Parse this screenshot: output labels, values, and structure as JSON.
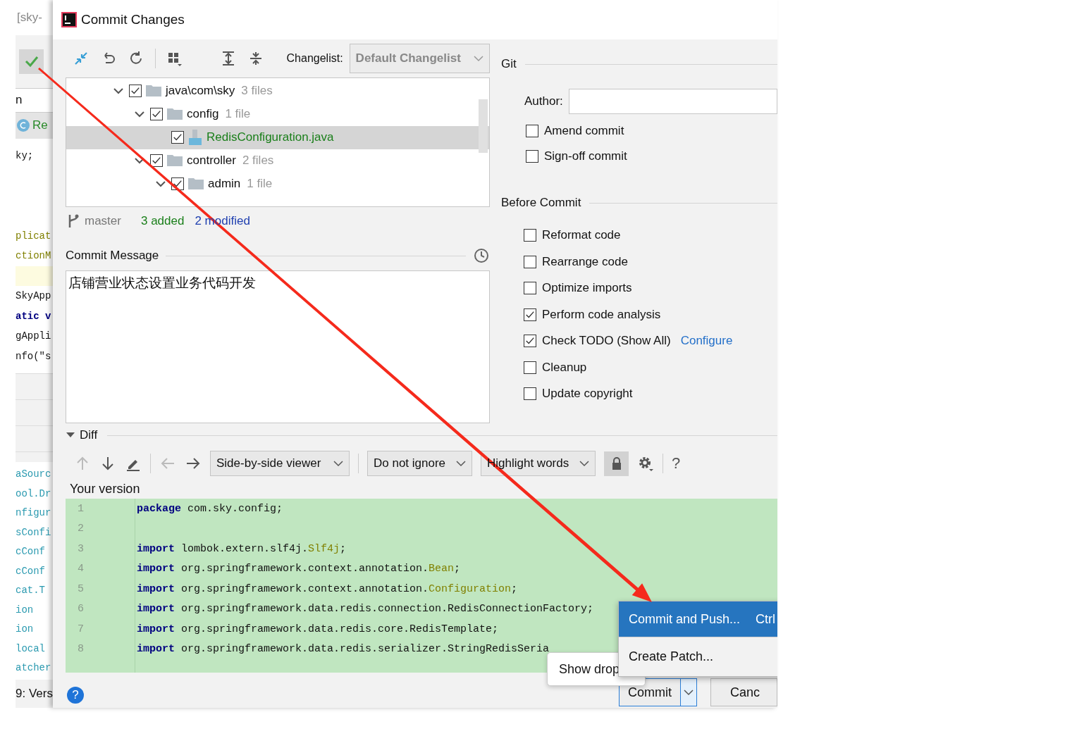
{
  "left_strip": {
    "title": "[sky-",
    "tab": "n",
    "file_tab": "Re",
    "code_groups": [
      [
        {
          "text": "ky;",
          "kind": "plain"
        }
      ],
      [
        {
          "text": "plicat",
          "kind": "annotation"
        },
        {
          "text": "ctionM",
          "kind": "annotation"
        }
      ],
      [
        {
          "text": "SkyApp",
          "kind": "plain"
        },
        {
          "text": "atic v",
          "kind": "keyword"
        },
        {
          "text": "gAppli",
          "kind": "plain"
        },
        {
          "text": "nfo(\"s",
          "kind": "plain"
        }
      ]
    ],
    "list": [
      "aSourc",
      "ool.Dr",
      "nfigur",
      "sConfi",
      "cConf",
      "cConf",
      "cat.T",
      "ion",
      "ion",
      "local",
      "atcher"
    ],
    "footer": "9: Vers"
  },
  "window": {
    "title": "Commit Changes"
  },
  "toolbar": {
    "changelist_label": "Changelist:",
    "changelist": "Default Changelist"
  },
  "tree": [
    {
      "name": "java\\com\\sky",
      "count": "3 files",
      "kind": "folder",
      "checked": true,
      "expanded": true,
      "selected": false,
      "children": [
        {
          "name": "config",
          "count": "1 file",
          "kind": "folder",
          "checked": true,
          "expanded": true,
          "selected": false,
          "children": [
            {
              "name": "RedisConfiguration.java",
              "kind": "added_file",
              "checked": true,
              "selected": true
            }
          ]
        },
        {
          "name": "controller",
          "count": "2 files",
          "kind": "folder",
          "checked": true,
          "expanded": true,
          "selected": false,
          "children": [
            {
              "name": "admin",
              "count": "1 file",
              "kind": "folder",
              "checked": true,
              "expanded": true,
              "selected": false
            }
          ]
        }
      ]
    }
  ],
  "status": {
    "branch": "master",
    "added": "3 added",
    "modified": "2 modified"
  },
  "commit_message": {
    "label": "Commit Message",
    "value": "店铺营业状态设置业务代码开发"
  },
  "git": {
    "title": "Git",
    "author_label": "Author:",
    "options": [
      {
        "label": "Amend commit",
        "checked": false
      },
      {
        "label": "Sign-off commit",
        "checked": false
      }
    ]
  },
  "before_commit": {
    "title": "Before Commit",
    "options": [
      {
        "label": "Reformat code",
        "checked": false
      },
      {
        "label": "Rearrange code",
        "checked": false
      },
      {
        "label": "Optimize imports",
        "checked": false
      },
      {
        "label": "Perform code analysis",
        "checked": true
      },
      {
        "label": "Check TODO (Show All)",
        "checked": true,
        "link": "Configure"
      },
      {
        "label": "Cleanup",
        "checked": false
      },
      {
        "label": "Update copyright",
        "checked": false
      }
    ]
  },
  "diff": {
    "title": "Diff",
    "expanded": true,
    "viewer": "Side-by-side viewer",
    "ignore": "Do not ignore",
    "highlight": "Highlight words",
    "locked": true,
    "help": "?",
    "version_label": "Your version",
    "lines": [
      {
        "number": "1",
        "keyword": "package",
        "text": " com.sky.config;"
      },
      {
        "number": "2"
      },
      {
        "number": "3",
        "keyword": "import",
        "text": " lombok.extern.slf4j.",
        "type_name": "Slf4j",
        "end": ";"
      },
      {
        "number": "4",
        "keyword": "import",
        "text": " org.springframework.context.annotation.",
        "type_name": "Bean",
        "end": ";"
      },
      {
        "number": "5",
        "keyword": "import",
        "text": " org.springframework.context.annotation.",
        "type_name": "Configuration",
        "end": ";"
      },
      {
        "number": "6",
        "keyword": "import",
        "text": " org.springframework.data.redis.connection.RedisConnectionFactory;"
      },
      {
        "number": "7",
        "keyword": "import",
        "text": " org.springframework.data.redis.core.RedisTemplate;"
      },
      {
        "number": "8",
        "keyword": "import",
        "text": " org.springframework.data.redis.serializer.StringRedisSeria"
      }
    ]
  },
  "tooltip": "Show drop",
  "menu": [
    {
      "label": "Commit and Push...",
      "shortcut": "Ctrl",
      "selected": true
    },
    {
      "label": "Create Patch...",
      "selected": false
    }
  ],
  "buttons": {
    "help": "?",
    "commit": "Commit",
    "cancel": "Canc"
  }
}
